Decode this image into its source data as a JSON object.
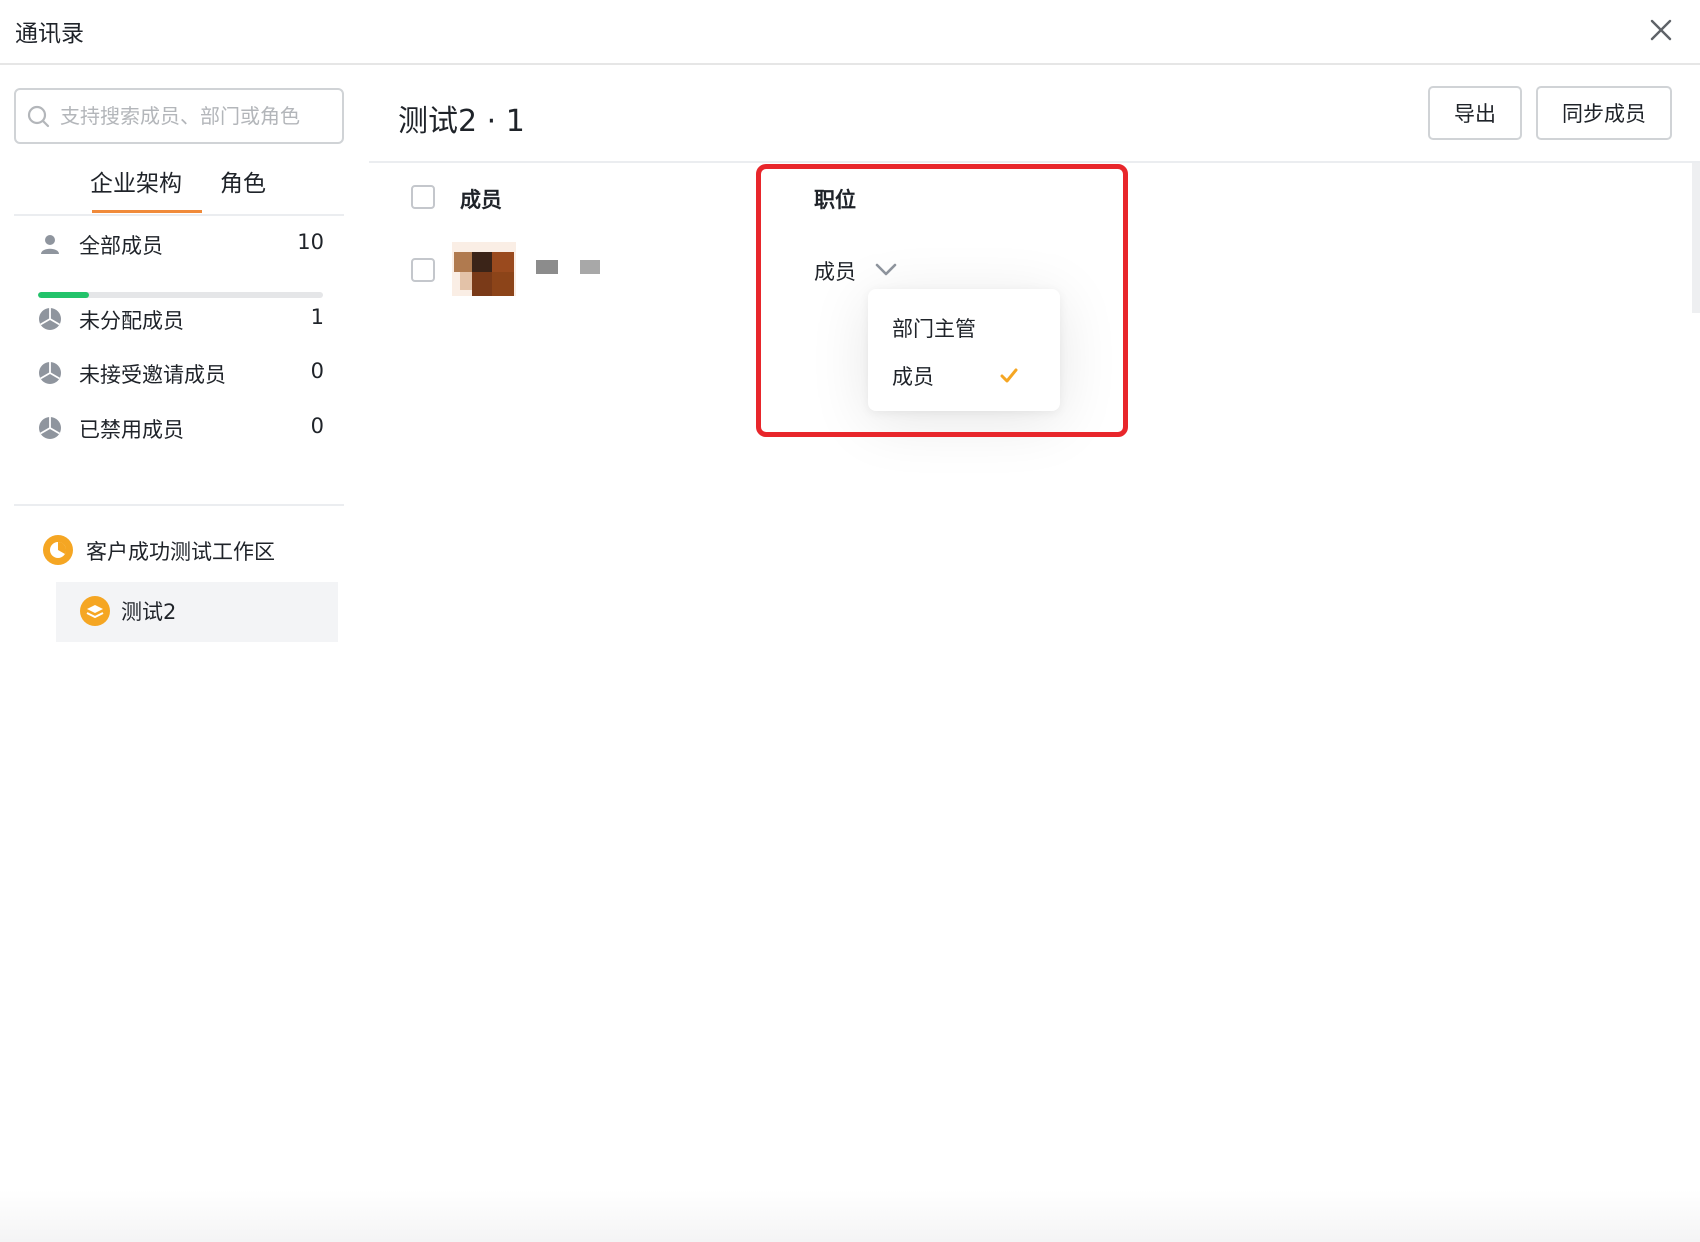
{
  "window": {
    "title": "通讯录"
  },
  "sidebar": {
    "search_placeholder": "支持搜索成员、部门或角色",
    "tabs": [
      {
        "label": "企业架构",
        "active": true
      },
      {
        "label": "角色",
        "active": false
      }
    ],
    "stats": [
      {
        "label": "全部成员",
        "count": "10",
        "icon": "user-icon"
      },
      {
        "label": "未分配成员",
        "count": "1",
        "icon": "pie-icon"
      },
      {
        "label": "未接受邀请成员",
        "count": "0",
        "icon": "pie-icon"
      },
      {
        "label": "已禁用成员",
        "count": "0",
        "icon": "pie-icon"
      }
    ],
    "all_members_progress": 0.18,
    "workspace": {
      "label": "客户成功测试工作区",
      "icon": "workspace-icon"
    },
    "department": {
      "label": "测试2",
      "icon": "department-icon",
      "selected": true
    }
  },
  "main": {
    "title": "测试2 · 1",
    "buttons": {
      "export": "导出",
      "sync": "同步成员"
    },
    "columns": {
      "member": "成员",
      "position": "职位"
    },
    "row": {
      "position_value": "成员"
    },
    "dropdown": {
      "options": [
        {
          "label": "部门主管",
          "selected": false
        },
        {
          "label": "成员",
          "selected": true
        }
      ]
    }
  },
  "colors": {
    "accent_orange": "#f08a3a",
    "progress_green": "#22c36a",
    "highlight_red": "#e8262b",
    "check_orange": "#f5a623"
  }
}
